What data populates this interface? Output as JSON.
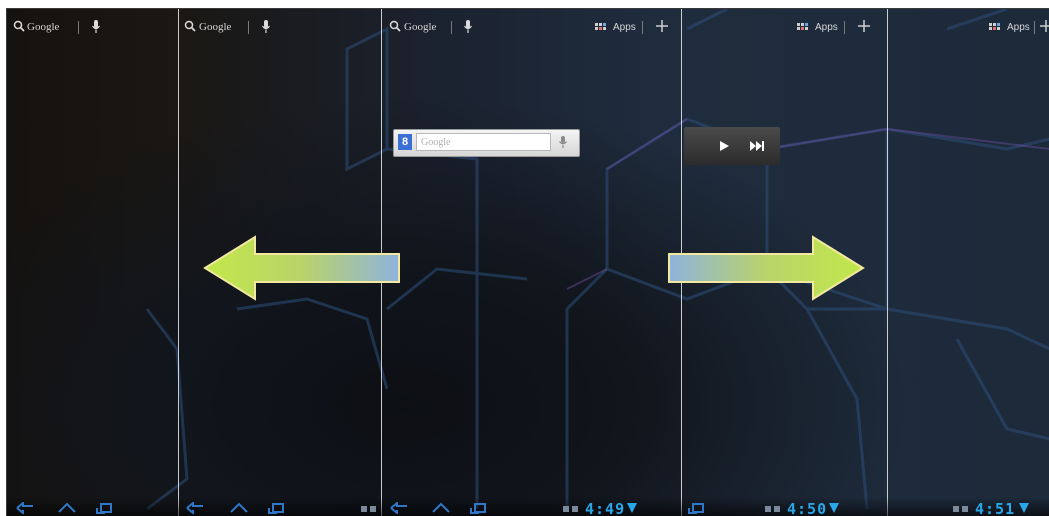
{
  "screens": [
    {
      "id": "screen-1",
      "search_label": "Google"
    },
    {
      "id": "screen-2",
      "search_label": "Google"
    },
    {
      "id": "screen-3",
      "search_label": "Google",
      "apps_label": "Apps",
      "clock": "4:49"
    },
    {
      "id": "screen-4",
      "apps_label": "Apps",
      "clock": "4:50"
    },
    {
      "id": "screen-5",
      "apps_label": "Apps",
      "clock": "4:51"
    }
  ],
  "google_widget": {
    "placeholder": "Google",
    "badge": "8"
  },
  "icons": {
    "search": "magnifier-icon",
    "voice": "microphone-icon",
    "apps": "apps-grid-icon",
    "add": "plus-icon",
    "play": "play-icon",
    "next": "skip-next-icon",
    "back": "back-icon",
    "home": "home-icon",
    "recents": "recent-apps-icon"
  },
  "colors": {
    "clock": "#2aa7e8",
    "arrow_start": "#b9e34a",
    "arrow_end": "#8fb3dc",
    "arrow_border": "#f2e8a0"
  }
}
